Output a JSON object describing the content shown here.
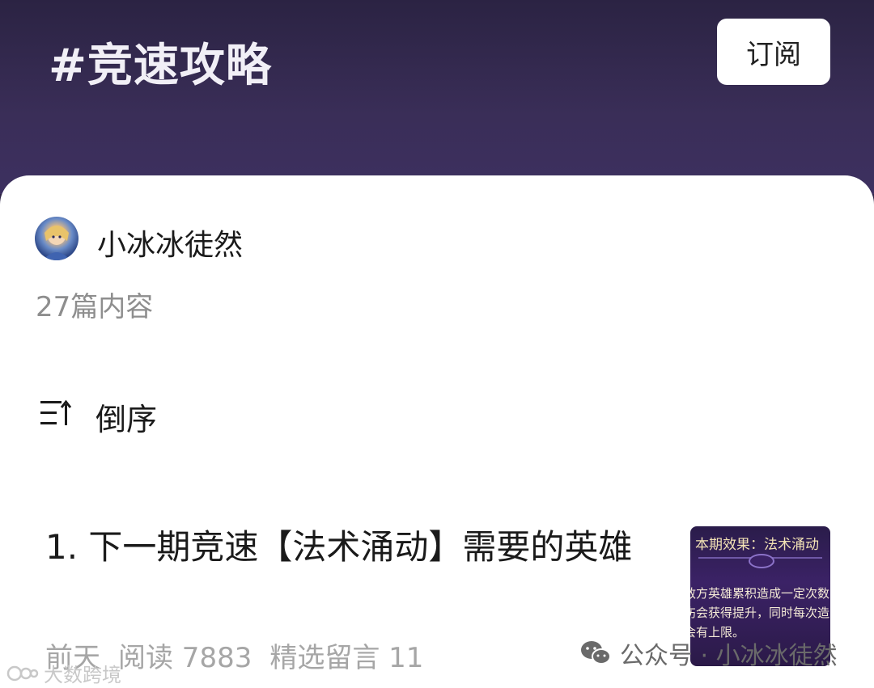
{
  "header": {
    "title": "#竞速攻略",
    "subscribe_label": "订阅"
  },
  "author": {
    "name": "小冰冰徒然",
    "count": "27篇内容"
  },
  "sort": {
    "icon": "sort-descending-icon",
    "label": "倒序"
  },
  "articles": [
    {
      "title": "1. 下一期竞速【法术涌动】需要的英雄",
      "date": "前天",
      "reads": "阅读 7883",
      "comments": "精选留言 11",
      "thumbnail": {
        "title": "本期效果：法术涌动",
        "lines": [
          "敌方英雄累积造成一定次数",
          "伤会获得提升，同时每次造",
          "会有上限。"
        ]
      }
    }
  ],
  "watermarks": {
    "account": "公众号 · 小冰冰徒然",
    "corner": "大数跨境"
  },
  "colors": {
    "header_bg": "#2b2343",
    "panel_bg": "#ffffff",
    "meta_text": "#a6a6a6"
  }
}
